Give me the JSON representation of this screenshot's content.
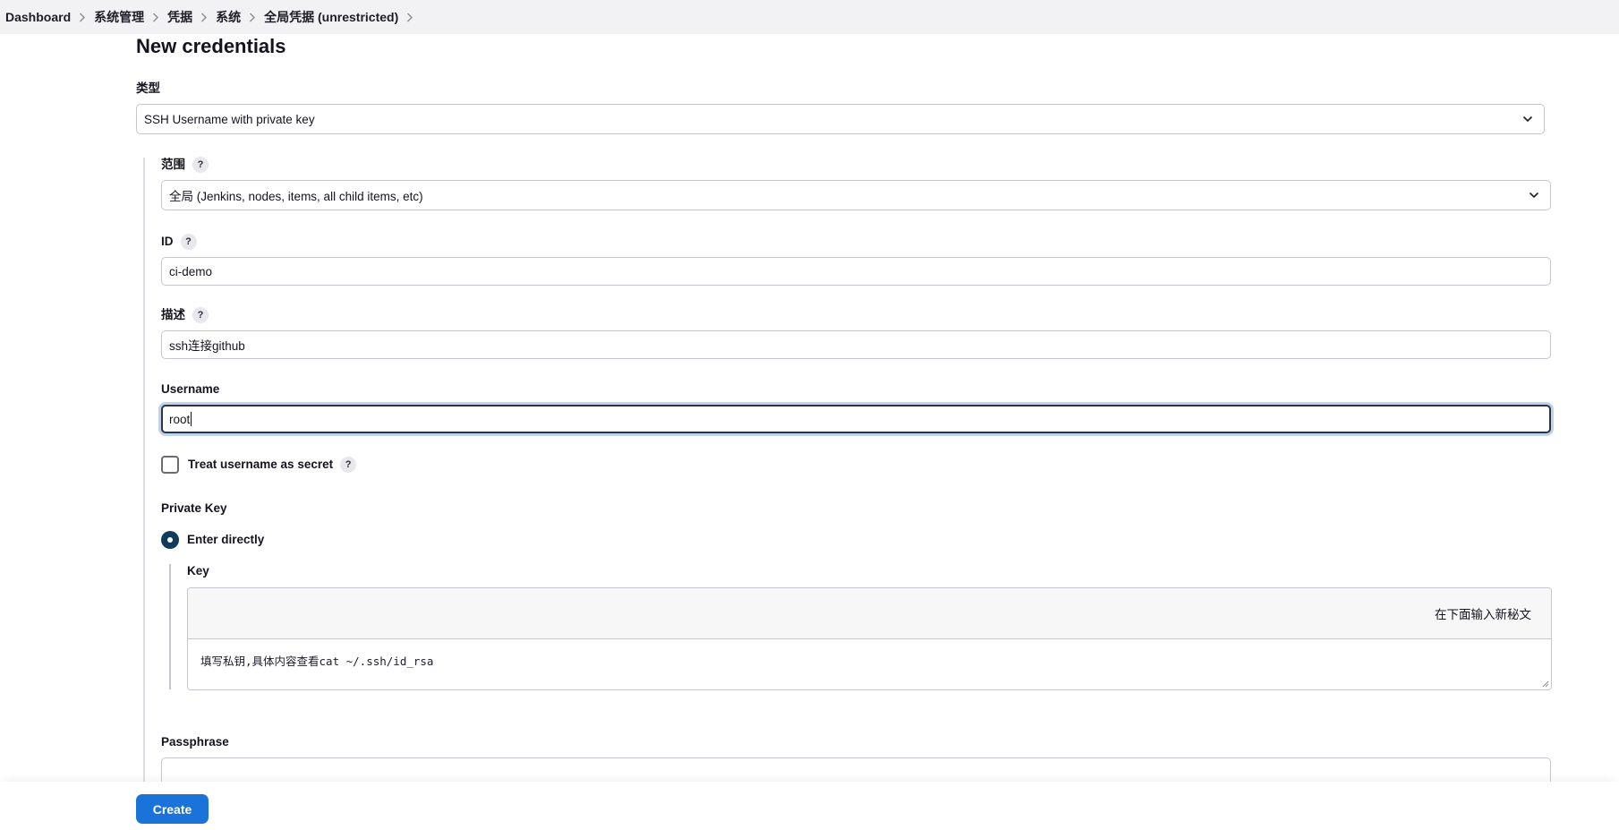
{
  "breadcrumb": [
    "Dashboard",
    "系统管理",
    "凭据",
    "系统",
    "全局凭据 (unrestricted)"
  ],
  "page_title": "New credentials",
  "type": {
    "label": "类型",
    "value": "SSH Username with private key"
  },
  "scope": {
    "label": "范围",
    "value": "全局 (Jenkins, nodes, items, all child items, etc)"
  },
  "id": {
    "label": "ID",
    "value": "ci-demo"
  },
  "description": {
    "label": "描述",
    "value": "ssh连接github"
  },
  "username": {
    "label": "Username",
    "value": "root"
  },
  "treat_secret": {
    "label": "Treat username as secret",
    "checked": false
  },
  "private_key": {
    "label": "Private Key",
    "option_label": "Enter directly",
    "selected": true,
    "key_label": "Key",
    "key_header": "在下面输入新秘文",
    "key_value": "填写私钥,具体内容查看cat ~/.ssh/id_rsa"
  },
  "passphrase": {
    "label": "Passphrase",
    "value": ""
  },
  "help_symbol": "?",
  "create_button": "Create",
  "colors": {
    "accent": "#1a73d9",
    "radio": "#0f3b5c",
    "focus_ring": "#bcd4ee"
  }
}
